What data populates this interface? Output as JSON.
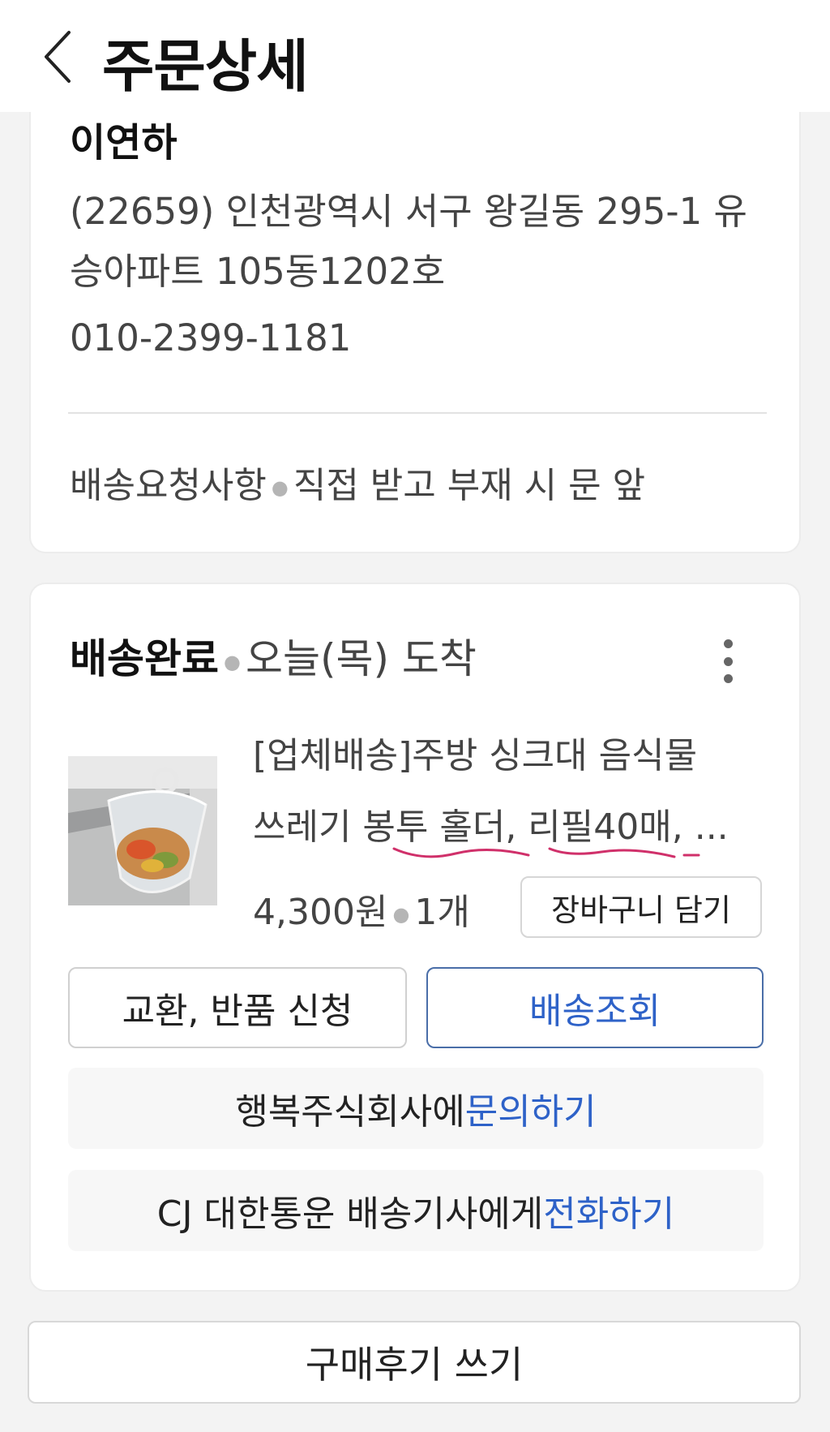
{
  "header": {
    "title": "주문상세"
  },
  "address_card": {
    "recipient_name": "이연하",
    "address": "(22659) 인천광역시 서구 왕길동 295-1 유승아파트 105동1202호",
    "phone": "010-2399-1181",
    "delivery_request_label": "배송요청사항",
    "delivery_request_value": "직접 받고 부재 시 문 앞"
  },
  "order_card": {
    "status": "배송완료",
    "arrival": "오늘(목) 도착",
    "product": {
      "name_line1": "[업체배송]주방 싱크대 음식물",
      "name_line2": "쓰레기 봉투 홀더, 리필40매, ...",
      "price": "4,300원",
      "quantity": "1개",
      "annotation_color": "#d0306a"
    },
    "cart_button": "장바구니 담기",
    "exchange_button": "교환, 반품 신청",
    "tracking_button": "배송조회",
    "seller_inquiry_prefix": "행복주식회사에 ",
    "seller_inquiry_link": "문의하기",
    "courier_prefix": "CJ 대한통운 배송기사에게 ",
    "courier_link": "전화하기"
  },
  "review_button": "구매후기 쓰기",
  "colors": {
    "accent_blue": "#2e62c8",
    "tracking_border": "#4a6ea8",
    "background": "#f3f3f3"
  }
}
